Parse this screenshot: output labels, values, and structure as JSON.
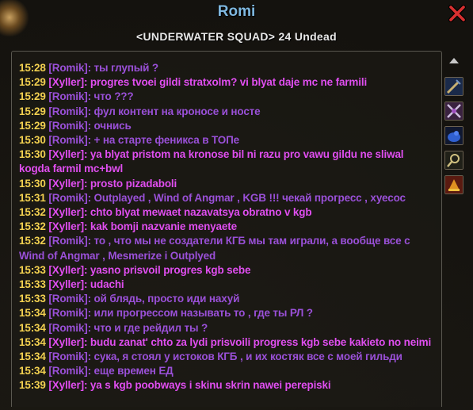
{
  "window": {
    "title": "Romi",
    "subtitle": "<UNDERWATER SQUAD> 24 Undead"
  },
  "icons": [
    {
      "name": "sword-icon"
    },
    {
      "name": "crossed-axes-icon"
    },
    {
      "name": "blue-creature-icon"
    },
    {
      "name": "magnifier-icon"
    },
    {
      "name": "guild-banner-icon"
    }
  ],
  "messages": [
    {
      "time": "15:28",
      "speaker": "[Romik]:",
      "type": "romik",
      "text": "ты глупый ?"
    },
    {
      "time": "15:29",
      "speaker": "[Xyller]:",
      "type": "xyller",
      "text": "progres tvoei gildi stratxolm? vi blyat daje mc ne farmili"
    },
    {
      "time": "15:29",
      "speaker": "[Romik]:",
      "type": "romik",
      "text": "что ???"
    },
    {
      "time": "15:29",
      "speaker": "[Romik]:",
      "type": "romik",
      "text": "фул контент на кроносе и носте"
    },
    {
      "time": "15:29",
      "speaker": "[Romik]:",
      "type": "romik",
      "text": "очнись"
    },
    {
      "time": "15:30",
      "speaker": "[Romik]:",
      "type": "romik",
      "text": "+ на старте феникса в ТОПе"
    },
    {
      "time": "15:30",
      "speaker": "[Xyller]:",
      "type": "xyller",
      "text": "ya blyat pristom na kronose bil ni razu pro vawu gildu ne sliwal kogda farmil mc+bwl"
    },
    {
      "time": "15:30",
      "speaker": "[Xyller]:",
      "type": "xyller",
      "text": "prosto pizadaboli"
    },
    {
      "time": "15:31",
      "speaker": "[Romik]:",
      "type": "romik",
      "text": "Outplayed , Wind of Angmar , KGB !!! чекай прогресс , хуесос"
    },
    {
      "time": "15:32",
      "speaker": "[Xyller]:",
      "type": "xyller",
      "text": "chto blyat mewaet nazavatsya obratno v kgb"
    },
    {
      "time": "15:32",
      "speaker": "[Xyller]:",
      "type": "xyller",
      "text": "kak bomji nazvanie menyaete"
    },
    {
      "time": "15:32",
      "speaker": "[Romik]:",
      "type": "romik",
      "text": "то , что мы не создатели КГБ мы там играли, а вообще все с Wind of Angmar , Mesmerize i Outplyed"
    },
    {
      "time": "15:33",
      "speaker": "[Xyller]:",
      "type": "xyller",
      "text": "yasno prisvoil progres kgb sebe"
    },
    {
      "time": "15:33",
      "speaker": "[Xyller]:",
      "type": "xyller",
      "text": "udachi"
    },
    {
      "time": "15:33",
      "speaker": "[Romik]:",
      "type": "romik",
      "text": "ой блядь, просто иди нахуй"
    },
    {
      "time": "15:34",
      "speaker": "[Romik]:",
      "type": "romik",
      "text": "или прогрессом называть то , где ты РЛ ?"
    },
    {
      "time": "15:34",
      "speaker": "[Romik]:",
      "type": "romik",
      "text": "что и где рейдил ты ?"
    },
    {
      "time": "15:34",
      "speaker": "[Xyller]:",
      "type": "xyller",
      "text": "budu zanat' chto za lydi prisvoili progress kgb sebe kakieto no neimi"
    },
    {
      "time": "15:34",
      "speaker": "[Romik]:",
      "type": "romik",
      "text": "сука, я стоял у истоков КГБ , и их костяк все с моей гильди"
    },
    {
      "time": "15:34",
      "speaker": "[Romik]:",
      "type": "romik",
      "text": "еще времен ЕД"
    },
    {
      "time": "15:39",
      "speaker": "[Xyller]:",
      "type": "xyller",
      "text": "ya s kgb poobways i skinu skrin nawei perepiski"
    }
  ],
  "colors": {
    "title": "#7fb8e0",
    "timestamp": "#f2d050",
    "romik": "#9a50d8",
    "xyller": "#e04ef0",
    "close": "#d83030"
  }
}
